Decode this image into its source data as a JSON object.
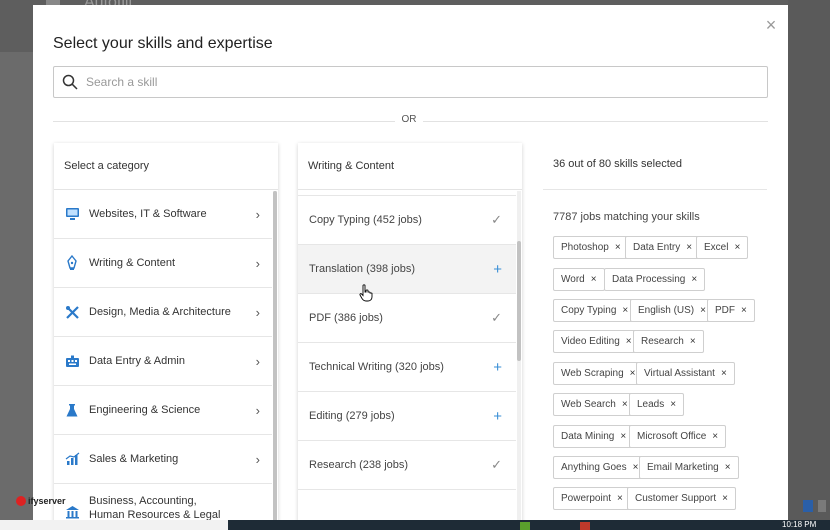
{
  "background": {
    "title": "Autofill"
  },
  "modal": {
    "title": "Select your skills and expertise",
    "close_label": "×",
    "search": {
      "placeholder": "Search a skill"
    },
    "or_label": "OR"
  },
  "categories": {
    "header": "Select a category",
    "items": [
      {
        "label": "Websites, IT & Software",
        "icon": "monitor-icon"
      },
      {
        "label": "Writing & Content",
        "icon": "pen-icon"
      },
      {
        "label": "Design, Media & Architecture",
        "icon": "design-tools-icon"
      },
      {
        "label": "Data Entry & Admin",
        "icon": "keyboard-icon"
      },
      {
        "label": "Engineering & Science",
        "icon": "flask-icon"
      },
      {
        "label": "Sales & Marketing",
        "icon": "chart-icon"
      },
      {
        "label": "Business, Accounting, Human Resources & Legal",
        "icon": "bank-icon"
      }
    ]
  },
  "subcategory": {
    "header": "Writing & Content",
    "items": [
      {
        "label": "Copy Typing (452 jobs)",
        "state": "selected"
      },
      {
        "label": "Translation (398 jobs)",
        "state": "add"
      },
      {
        "label": "PDF (386 jobs)",
        "state": "selected"
      },
      {
        "label": "Technical Writing (320 jobs)",
        "state": "add"
      },
      {
        "label": "Editing (279 jobs)",
        "state": "add"
      },
      {
        "label": "Research (238 jobs)",
        "state": "selected"
      }
    ]
  },
  "selection": {
    "count_text": "36 out of 80 skills selected",
    "jobs_text": "7787 jobs matching your skills",
    "chips": [
      "Photoshop",
      "Data Entry",
      "Excel",
      "Word",
      "Data Processing",
      "Copy Typing",
      "English (US)",
      "PDF",
      "Video Editing",
      "Research",
      "Web Scraping",
      "Virtual Assistant",
      "Web Search",
      "Leads",
      "Data Mining",
      "Microsoft Office",
      "Anything Goes",
      "Email Marketing",
      "Powerpoint",
      "Customer Support"
    ]
  },
  "colors": {
    "accent": "#3a8fd6",
    "check": "#888888"
  },
  "watermark": {
    "text": "ifyserver"
  },
  "taskbar": {
    "time": "10:18 PM"
  }
}
